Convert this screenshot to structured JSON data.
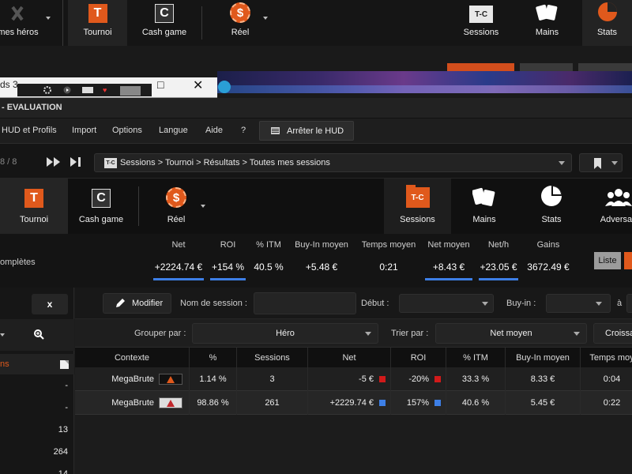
{
  "bg_window": {
    "nav": [
      {
        "label": "mes héros",
        "icon": "hero-icon"
      },
      {
        "label": "Tournoi",
        "icon": "T"
      },
      {
        "label": "Cash game",
        "icon": "C"
      },
      {
        "label": "Réel",
        "icon": "$"
      },
      {
        "label": "Sessions",
        "icon": "T-C"
      },
      {
        "label": "Mains",
        "icon": "cards-icon"
      },
      {
        "label": "Stats",
        "icon": "pie-icon"
      }
    ],
    "small_title": "ds 3"
  },
  "app": {
    "title": "- EVALUATION",
    "menu": [
      "HUD et Profils",
      "Import",
      "Options",
      "Langue",
      "Aide",
      "?"
    ],
    "hud_button": "Arrêter le HUD",
    "page_counter": "8 / 8",
    "breadcrumb_icon": "T-C",
    "breadcrumb": "Sessions > Tournoi > Résultats > Toutes mes sessions"
  },
  "tabs": {
    "left": [
      {
        "label": "Tournoi",
        "icon": "T"
      },
      {
        "label": "Cash game",
        "icon": "C"
      },
      {
        "label": "Réel",
        "icon": "$"
      }
    ],
    "right": [
      {
        "label": "Sessions",
        "icon": "T-C"
      },
      {
        "label": "Mains",
        "icon": "cards-icon"
      },
      {
        "label": "Stats",
        "icon": "pie-icon"
      },
      {
        "label": "Adversair",
        "icon": "users-icon"
      }
    ]
  },
  "stats": {
    "left_label": "omplètes",
    "items": [
      {
        "label": "Net",
        "value": "+2224.74 €",
        "bar": true
      },
      {
        "label": "ROI",
        "value": "+154 %",
        "bar": true
      },
      {
        "label": "% ITM",
        "value": "40.5 %",
        "bar": false
      },
      {
        "label": "Buy-In moyen",
        "value": "+5.48 €",
        "bar": false
      },
      {
        "label": "Temps moyen",
        "value": "0:21",
        "bar": false
      },
      {
        "label": "Net moyen",
        "value": "+8.43 €",
        "bar": true
      },
      {
        "label": "Net/h",
        "value": "+23.05 €",
        "bar": true
      },
      {
        "label": "Gains",
        "value": "3672.49 €",
        "bar": false
      }
    ],
    "liste_button": "Liste"
  },
  "left_panel": {
    "x_button": "x",
    "header_label": "ns",
    "rows": [
      "-",
      "-",
      "13",
      "264",
      "14"
    ]
  },
  "filters": {
    "modifier": "Modifier",
    "session_name_label": "Nom de session :",
    "session_name_value": "",
    "debut_label": "Début :",
    "debut_value": "",
    "buyin_label": "Buy-in :",
    "buyin_value": "",
    "a_label": "à"
  },
  "grouping": {
    "group_label": "Grouper par :",
    "group_value": "Héro",
    "sort_label": "Trier par :",
    "sort_value": "Net moyen",
    "order_value": "Croissa"
  },
  "table": {
    "headers": [
      "Contexte",
      "%",
      "Sessions",
      "Net",
      "ROI",
      "% ITM",
      "Buy-In moyen",
      "Temps moy"
    ],
    "rows": [
      {
        "contexte": "MegaBrute",
        "pct": "1.14 %",
        "sessions": "3",
        "net": "-5 €",
        "roi": "-20%",
        "itm": "33.3 %",
        "buyin": "8.33 €",
        "temps": "0:04",
        "color": "#d11a1a"
      },
      {
        "contexte": "MegaBrute",
        "pct": "98.86 %",
        "sessions": "261",
        "net": "+2229.74 €",
        "roi": "157%",
        "itm": "40.6 %",
        "buyin": "5.45 €",
        "temps": "0:22",
        "color": "#3d7fe6"
      }
    ]
  },
  "colors": {
    "accent": "#e0591c",
    "positive_bar": "#3d7fe6",
    "negative": "#d11a1a"
  }
}
